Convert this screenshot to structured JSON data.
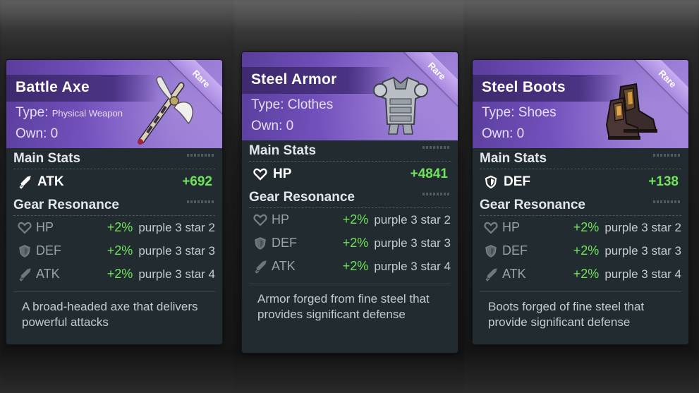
{
  "cards": [
    {
      "name": "Battle Axe",
      "type_label": "Type:",
      "type_value": "Physical Weapon",
      "own_label": "Own:",
      "own_value": "0",
      "rarity": "Rare",
      "art_icon": "battle-axe-icon",
      "main_stats_title": "Main Stats",
      "main_stat": {
        "icon": "sword-icon",
        "name": "ATK",
        "value": "+692"
      },
      "resonance_title": "Gear Resonance",
      "resonance": [
        {
          "icon": "heart-icon",
          "name": "HP",
          "pct": "+2%",
          "req": "purple 3 star 2"
        },
        {
          "icon": "shield-icon",
          "name": "DEF",
          "pct": "+2%",
          "req": "purple 3 star 3"
        },
        {
          "icon": "sword-icon",
          "name": "ATK",
          "pct": "+2%",
          "req": "purple 3 star 4"
        }
      ],
      "description": "A broad-headed axe that delivers powerful attacks"
    },
    {
      "name": "Steel Armor",
      "type_label": "Type:",
      "type_value": "Clothes",
      "own_label": "Own:",
      "own_value": "0",
      "rarity": "Rare",
      "art_icon": "steel-armor-icon",
      "main_stats_title": "Main Stats",
      "main_stat": {
        "icon": "heart-icon",
        "name": "HP",
        "value": "+4841"
      },
      "resonance_title": "Gear Resonance",
      "resonance": [
        {
          "icon": "heart-icon",
          "name": "HP",
          "pct": "+2%",
          "req": "purple 3 star 2"
        },
        {
          "icon": "shield-icon",
          "name": "DEF",
          "pct": "+2%",
          "req": "purple 3 star 3"
        },
        {
          "icon": "sword-icon",
          "name": "ATK",
          "pct": "+2%",
          "req": "purple 3 star 4"
        }
      ],
      "description": "Armor forged from fine steel that provides significant defense"
    },
    {
      "name": "Steel Boots",
      "type_label": "Type:",
      "type_value": "Shoes",
      "own_label": "Own:",
      "own_value": "0",
      "rarity": "Rare",
      "art_icon": "steel-boots-icon",
      "main_stats_title": "Main Stats",
      "main_stat": {
        "icon": "shield-icon",
        "name": "DEF",
        "value": "+138"
      },
      "resonance_title": "Gear Resonance",
      "resonance": [
        {
          "icon": "heart-icon",
          "name": "HP",
          "pct": "+2%",
          "req": "purple 3 star 2"
        },
        {
          "icon": "shield-icon",
          "name": "DEF",
          "pct": "+2%",
          "req": "purple 3 star 3"
        },
        {
          "icon": "sword-icon",
          "name": "ATK",
          "pct": "+2%",
          "req": "purple 3 star 4"
        }
      ],
      "description": "Boots forged of fine steel that provide significant defense"
    }
  ],
  "colors": {
    "header_purple": "#7654c0",
    "card_bg": "#222b30",
    "stat_green": "#6fe35a"
  }
}
